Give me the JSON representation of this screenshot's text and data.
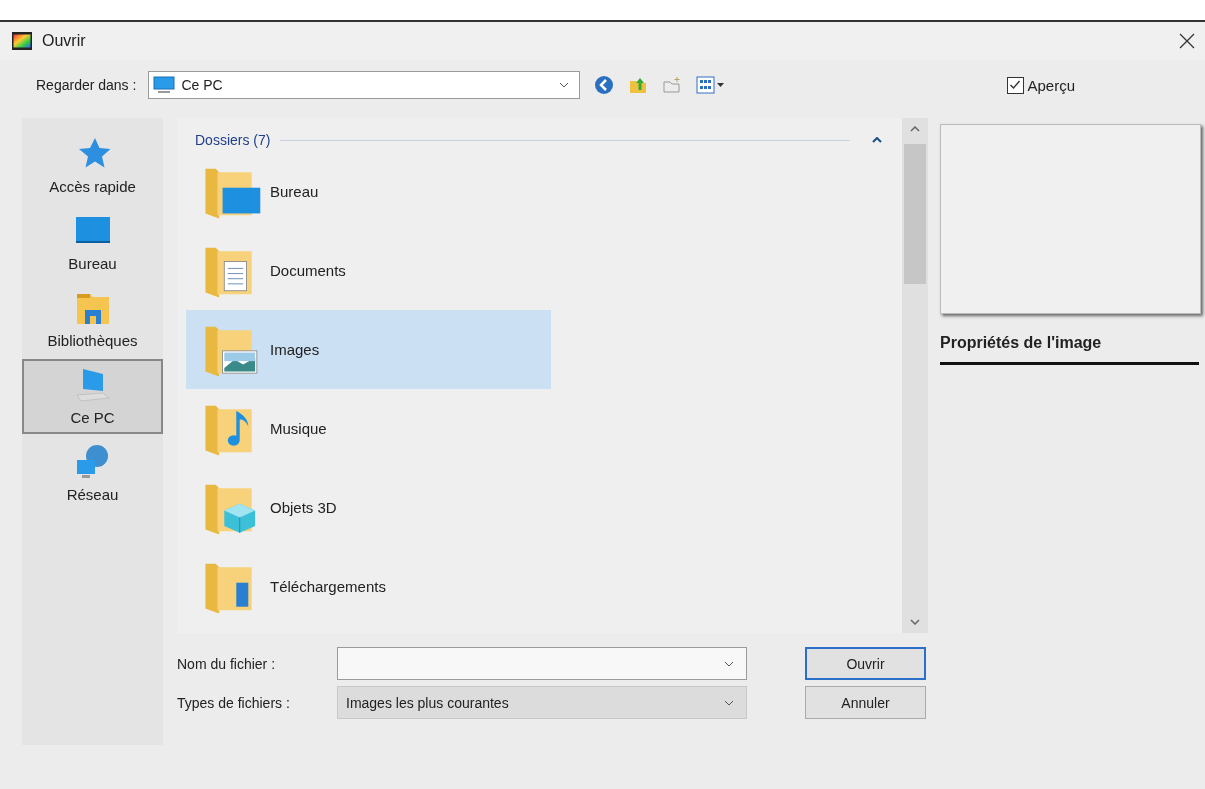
{
  "window": {
    "title": "Ouvrir"
  },
  "look_in": {
    "label": "Regarder dans :",
    "value": "Ce PC"
  },
  "preview": {
    "label": "Aperçu",
    "checked": true,
    "properties_title": "Propriétés de l'image"
  },
  "sidebar": {
    "items": [
      {
        "label": "Accès rapide",
        "kind": "star",
        "selected": false
      },
      {
        "label": "Bureau",
        "kind": "desktop",
        "selected": false
      },
      {
        "label": "Bibliothèques",
        "kind": "library",
        "selected": false
      },
      {
        "label": "Ce PC",
        "kind": "pc",
        "selected": true
      },
      {
        "label": "Réseau",
        "kind": "network",
        "selected": false
      }
    ]
  },
  "group": {
    "title": "Dossiers (7)",
    "expanded": true
  },
  "folders": [
    {
      "name": "Bureau",
      "kind": "desktop",
      "selected": false
    },
    {
      "name": "Documents",
      "kind": "documents",
      "selected": false
    },
    {
      "name": "Images",
      "kind": "pictures",
      "selected": true
    },
    {
      "name": "Musique",
      "kind": "music",
      "selected": false
    },
    {
      "name": "Objets 3D",
      "kind": "cube",
      "selected": false
    },
    {
      "name": "Téléchargements",
      "kind": "download",
      "selected": false
    }
  ],
  "file_name": {
    "label": "Nom du fichier :"
  },
  "file_type": {
    "label": "Types de fichiers :",
    "value": "Images les plus courantes"
  },
  "buttons": [
    {
      "label": "Ouvrir",
      "kind": "default"
    },
    {
      "label": "Annuler",
      "kind": "normal"
    }
  ]
}
